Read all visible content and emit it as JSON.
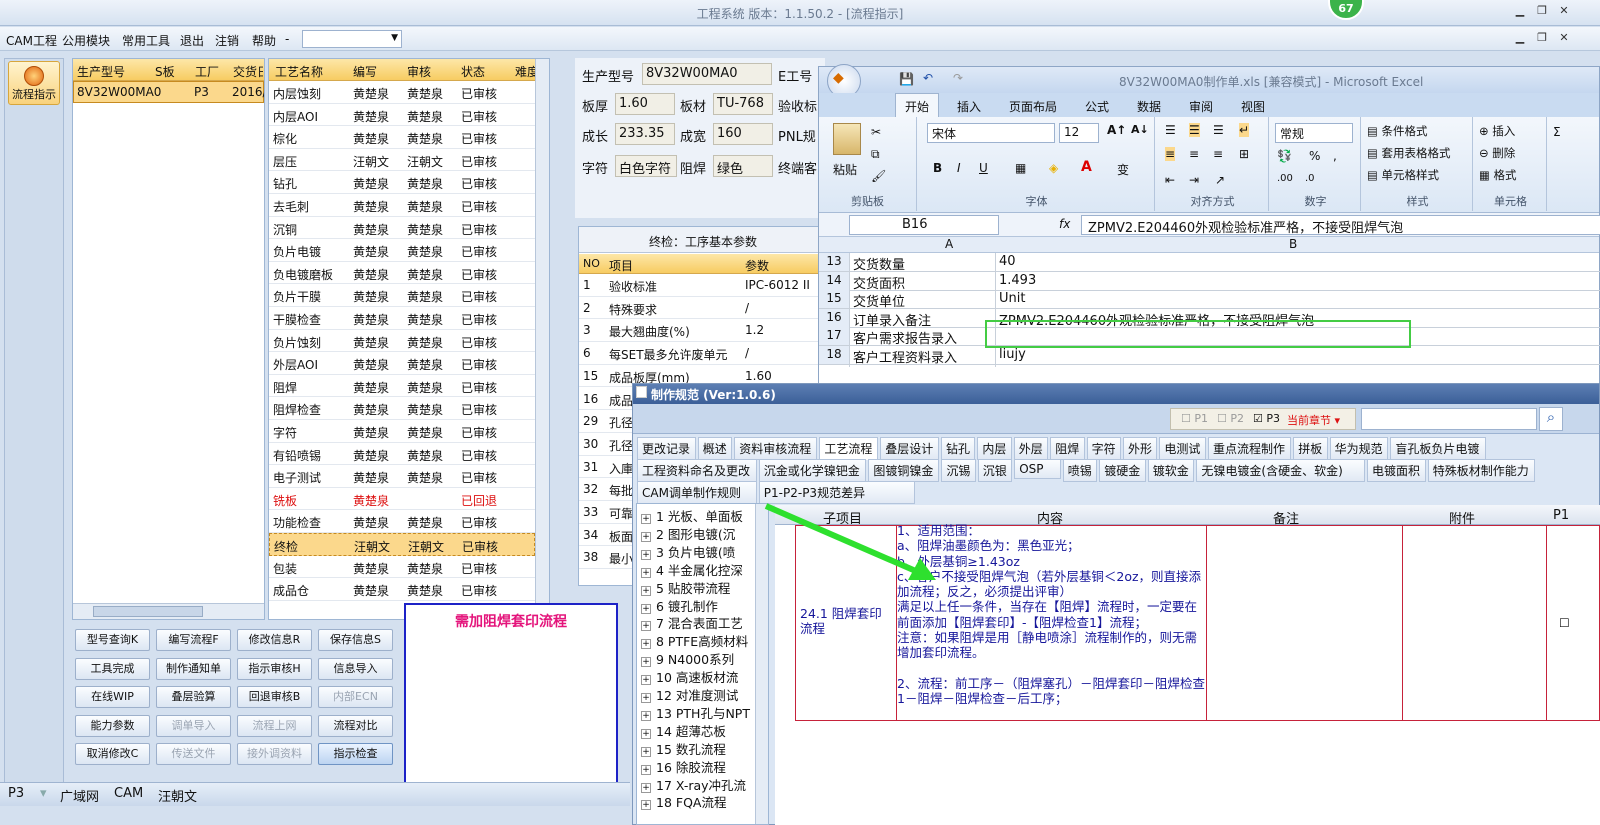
{
  "window": {
    "title": "工程系统  版本：1.1.50.2 - [流程指示]",
    "badge": "67"
  },
  "menu": {
    "items": [
      "CAM工程",
      "公用模块",
      "常用工具",
      "退出",
      "注销",
      "帮助",
      "-"
    ]
  },
  "sidebar": {
    "flow_button": "流程指示"
  },
  "order_grid": {
    "headers": [
      "生产型号",
      "S板",
      "工厂",
      "交货日"
    ],
    "row": [
      "8V32W00MA0",
      "",
      "P3",
      "2016/"
    ]
  },
  "process_grid": {
    "headers": [
      "工艺名称",
      "编写",
      "审核",
      "状态",
      "难度"
    ],
    "rows": [
      [
        "内层蚀刻",
        "黄楚泉",
        "黄楚泉",
        "已审核"
      ],
      [
        "内层AOI",
        "黄楚泉",
        "黄楚泉",
        "已审核"
      ],
      [
        "棕化",
        "黄楚泉",
        "黄楚泉",
        "已审核"
      ],
      [
        "层压",
        "汪朝文",
        "汪朝文",
        "已审核"
      ],
      [
        "钻孔",
        "黄楚泉",
        "黄楚泉",
        "已审核"
      ],
      [
        "去毛刺",
        "黄楚泉",
        "黄楚泉",
        "已审核"
      ],
      [
        "沉铜",
        "黄楚泉",
        "黄楚泉",
        "已审核"
      ],
      [
        "负片电镀",
        "黄楚泉",
        "黄楚泉",
        "已审核"
      ],
      [
        "负电镀磨板",
        "黄楚泉",
        "黄楚泉",
        "已审核"
      ],
      [
        "负片干膜",
        "黄楚泉",
        "黄楚泉",
        "已审核"
      ],
      [
        "干膜检查",
        "黄楚泉",
        "黄楚泉",
        "已审核"
      ],
      [
        "负片蚀刻",
        "黄楚泉",
        "黄楚泉",
        "已审核"
      ],
      [
        "外层AOI",
        "黄楚泉",
        "黄楚泉",
        "已审核"
      ],
      [
        "阻焊",
        "黄楚泉",
        "黄楚泉",
        "已审核"
      ],
      [
        "阻焊检查",
        "黄楚泉",
        "黄楚泉",
        "已审核"
      ],
      [
        "字符",
        "黄楚泉",
        "黄楚泉",
        "已审核"
      ],
      [
        "有铅喷锡",
        "黄楚泉",
        "黄楚泉",
        "已审核"
      ],
      [
        "电子测试",
        "黄楚泉",
        "黄楚泉",
        "已审核"
      ],
      [
        "铣板",
        "黄楚泉",
        "",
        "已回退"
      ],
      [
        "功能检查",
        "黄楚泉",
        "黄楚泉",
        "已审核"
      ],
      [
        "终检",
        "汪朝文",
        "汪朝文",
        "已审核"
      ],
      [
        "包装",
        "黄楚泉",
        "黄楚泉",
        "已审核"
      ],
      [
        "成品仓",
        "黄楚泉",
        "黄楚泉",
        "已审核"
      ]
    ]
  },
  "buttons": [
    [
      "型号查询K",
      "编写流程F",
      "修改信息R",
      "保存信息S"
    ],
    [
      "工具完成",
      "制作通知单",
      "指示审核H",
      "信息导入"
    ],
    [
      "在线WIP",
      "叠层验算",
      "回退审核B",
      "内部ECN"
    ],
    [
      "能力参数",
      "调单导入",
      "流程上网",
      "流程对比"
    ],
    [
      "取消修改C",
      "传送文件",
      "接外调资料",
      "指示检查"
    ]
  ],
  "note": {
    "text": "需加阻焊套印流程"
  },
  "status": {
    "items": [
      "P3",
      "广域网",
      "CAM",
      "汪朝文"
    ]
  },
  "params": {
    "model_label": "生产型号",
    "model": "8V32W00MA0",
    "eng_label": "E工号",
    "thick_label": "板厚",
    "thick": "1.60",
    "mat_label": "板材",
    "mat": "TU-768",
    "accept_label": "验收标",
    "len_label": "成长",
    "len": "233.35",
    "wid_label": "成宽",
    "wid": "160",
    "pnl_label": "PNL规",
    "char_label": "字符",
    "char": "白色字符",
    "mask_label": "阻焊",
    "mask": "绿色",
    "term_label": "终端客"
  },
  "param_table": {
    "title": "终检：工序基本参数",
    "headers": [
      "NO",
      "项目",
      "参数"
    ],
    "rows": [
      [
        "1",
        "验收标准",
        "IPC-6012 II"
      ],
      [
        "2",
        "特殊要求",
        "/"
      ],
      [
        "3",
        "最大翘曲度(%)",
        "1.2"
      ],
      [
        "6",
        "每SET最多允许废单元",
        "/"
      ],
      [
        "15",
        "成品板厚(mm)",
        "1.60"
      ],
      [
        "16",
        "成品",
        ""
      ],
      [
        "29",
        "孔径",
        ""
      ],
      [
        "30",
        "孔径",
        ""
      ],
      [
        "31",
        "入庫",
        ""
      ],
      [
        "32",
        "每批",
        ""
      ],
      [
        "33",
        "可靠",
        ""
      ],
      [
        "34",
        "板面",
        ""
      ],
      [
        "38",
        "最小",
        ""
      ]
    ]
  },
  "excel": {
    "title": "8V32W00MA0制作单.xls [兼容模式] - Microsoft Excel",
    "tabs": [
      "开始",
      "插入",
      "页面布局",
      "公式",
      "数据",
      "审阅",
      "视图"
    ],
    "font": "宋体",
    "size": "12",
    "number_format": "常规",
    "groups": [
      "剪贴板",
      "字体",
      "对齐方式",
      "数字",
      "样式",
      "单元格"
    ],
    "paste": "粘贴",
    "style_items": [
      "条件格式",
      "套用表格格式",
      "单元格样式"
    ],
    "cell_items": [
      "插入",
      "删除",
      "格式"
    ],
    "cell_ref": "B16",
    "formula": "ZPMV2.E204460外观检验标准严格，不接受阻焊气泡",
    "col_headers": [
      "A",
      "B"
    ],
    "rows": [
      [
        "13",
        "交货数量",
        "40"
      ],
      [
        "14",
        "交货面积",
        "1.493"
      ],
      [
        "15",
        "交货单位",
        "Unit"
      ],
      [
        "16",
        "订单录入备注",
        "ZPMV2.E204460外观检验标准严格，不接受阻焊气泡"
      ],
      [
        "17",
        "客户需求报告录入",
        ""
      ],
      [
        "18",
        "客户工程资料录入",
        "liujy"
      ]
    ]
  },
  "spec": {
    "title": "制作规范 (Ver:1.0.6)",
    "filters": [
      "P1",
      "P2",
      "P3",
      "当前章节"
    ],
    "tabs1": [
      "更改记录",
      "概述",
      "资料审核流程",
      "工艺流程",
      "叠层设计",
      "钻孔",
      "内层",
      "外层",
      "阻焊",
      "字符",
      "外形",
      "电测试",
      "重点流程制作",
      "拼板",
      "华为规范",
      "盲孔板负片电镀"
    ],
    "tabs2": [
      "工程资料命名及更改",
      "沉金或化学镍钯金",
      "图镀铜镍金",
      "沉锡",
      "沉银",
      "OSP",
      "喷锡",
      "镀硬金",
      "镀软金",
      "无镍电镀金(含硬金、软金)",
      "电镀面积",
      "特殊板材制作能力"
    ],
    "tabs3": [
      "CAM调单制作规则",
      "P1-P2-P3规范差异"
    ],
    "tree": [
      "1 光板、单面板",
      "2 图形电镀(沉",
      "3 负片电镀(喷",
      "4 半金属化控深",
      "5 贴胶带流程",
      "6 镀孔制作",
      "7 混合表面工艺",
      "8 PTFE高频材料",
      "9 N4000系列",
      "10 高速板材流",
      "12 对准度测试",
      "13 PTH孔与NPT",
      "14 超薄芯板",
      "15 数孔流程",
      "16 除胶流程",
      "17 X-ray冲孔流",
      "18 FQA流程"
    ],
    "table_headers": [
      "子项目",
      "内容",
      "备注",
      "附件",
      "P1"
    ],
    "subitem": "24.1 阻焊套印流程",
    "content": [
      "1、适用范围：",
      "  a、阻焊油墨颜色为：黑色亚光；",
      "  b、外层基铜≥1.43oz",
      "  c、客户不接受阻焊气泡（若外层基铜＜2oz，则直接添加流程；反之，必须提出评审）",
      "  满足以上任一条件，当存在【阻焊】流程时，一定要在前面添加【阻焊套印】-【阻焊检查1】流程；",
      "注意：如果阻焊是用［静电喷涂］流程制作的，则无需增加套印流程。",
      "",
      "2、流程：前工序－（阻焊塞孔）－阻焊套印－阻焊检查1－阻焊－阻焊检查－后工序；"
    ]
  },
  "colors": {
    "highlight": "#fbd88c",
    "arrow": "#2ee02e",
    "note_border": "#1d22c7",
    "note_text": "#e4147b"
  }
}
